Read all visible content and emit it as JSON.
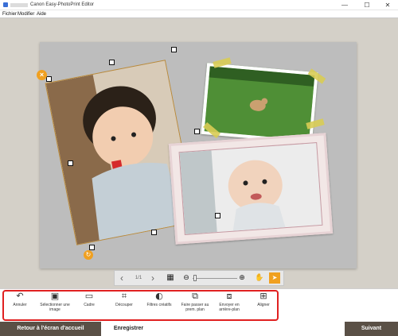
{
  "window": {
    "title": "Canon Easy-PhotoPrint Editor",
    "minimize_glyph": "—",
    "maximize_glyph": "☐",
    "close_glyph": "✕"
  },
  "menu": {
    "items": [
      "Fichier",
      "Modifier",
      "Aide"
    ]
  },
  "navigation": {
    "prev_glyph": "‹",
    "page_indicator": "1/1",
    "next_glyph": "›",
    "grid_glyph": "▦",
    "zoom_out_glyph": "⊖",
    "zoom_in_glyph": "⊕",
    "hand_glyph": "✋",
    "pointer_glyph": "➤"
  },
  "badges": {
    "close_glyph": "×",
    "rotate_glyph": "↻"
  },
  "toolbar": {
    "tools": [
      {
        "label": "Annuler",
        "icon": "undo-icon",
        "glyph": "↶"
      },
      {
        "label": "Sélectionner une image",
        "icon": "select-image-icon",
        "glyph": "▣"
      },
      {
        "label": "Cadre",
        "icon": "frame-icon",
        "glyph": "▭"
      },
      {
        "label": "Découper",
        "icon": "crop-icon",
        "glyph": "⌗"
      },
      {
        "label": "Filtres créatifs",
        "icon": "filter-icon",
        "glyph": "◐"
      },
      {
        "label": "Faire passer au prem. plan",
        "icon": "bring-forward-icon",
        "glyph": "⧉"
      },
      {
        "label": "Envoyer en arrière-plan",
        "icon": "send-backward-icon",
        "glyph": "⧈"
      },
      {
        "label": "Aligner",
        "icon": "align-icon",
        "glyph": "⊞"
      }
    ]
  },
  "bottom": {
    "home_label": "Retour à l'écran d'accueil",
    "save_label": "Enregistrer",
    "next_label": "Suivant"
  },
  "colors": {
    "accent": "#f0a020",
    "highlight_frame": "#e02020",
    "footer_button": "#5a5046"
  }
}
